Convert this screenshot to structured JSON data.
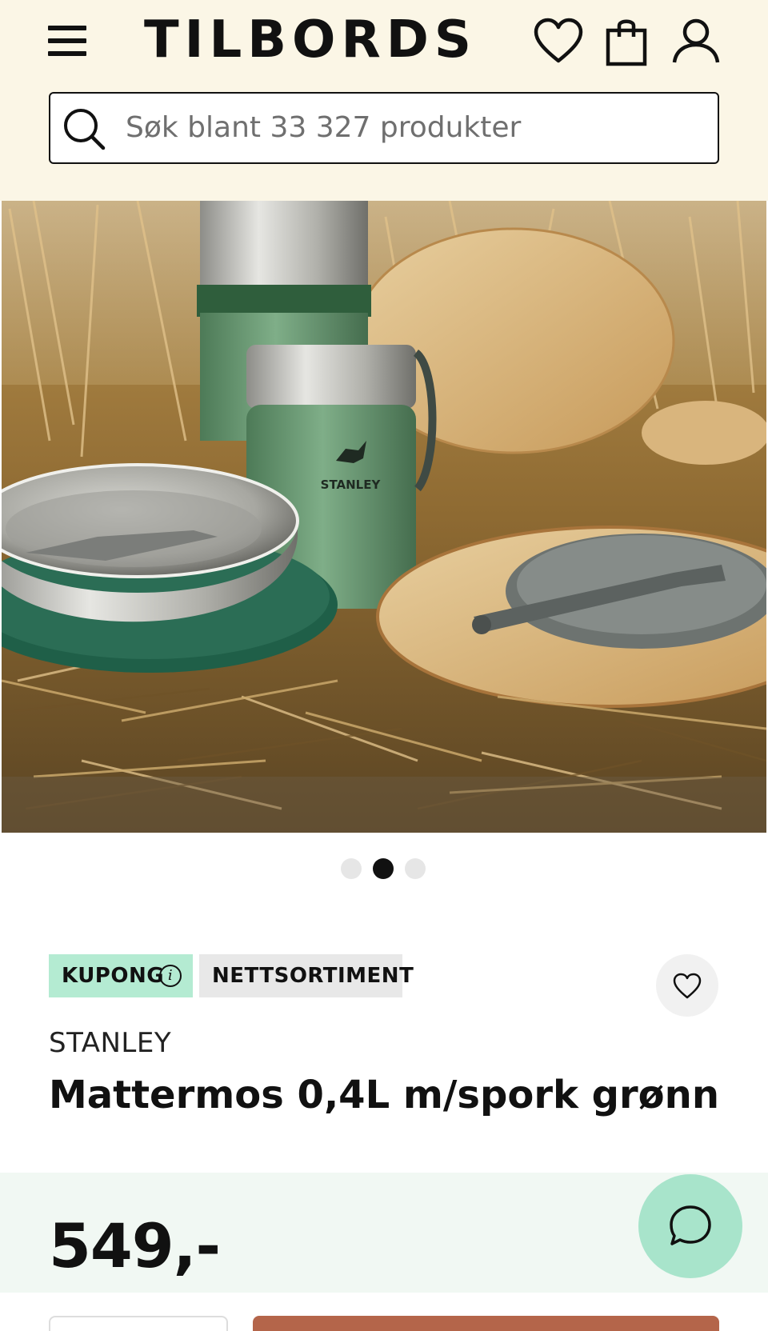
{
  "header": {
    "logo": "TILBORDS",
    "search": {
      "placeholder": "Søk blant 33 327 produkter",
      "value": ""
    }
  },
  "icons": {
    "menu": "menu-icon",
    "favorites": "heart-icon",
    "cart": "shopping-bag-icon",
    "account": "user-icon",
    "search": "search-icon",
    "chat": "chat-bubble-icon"
  },
  "carousel": {
    "slide_count": 3,
    "active_index": 1
  },
  "product": {
    "badges": [
      {
        "label": "KUPONG",
        "info_glyph": "i"
      },
      {
        "label": "NETTSORTIMENT"
      }
    ],
    "brand": "STANLEY",
    "title": "Mattermos 0,4L m/spork grønn",
    "price": "549,-"
  },
  "hero_image": {
    "thermos_brand": "STANLEY"
  },
  "colors": {
    "header_bg": "#fbf6e6",
    "coupon_badge": "#b4ebd2",
    "price_band": "#f1f8f3",
    "chat_button": "#a8e4cb",
    "buy_button": "#b4654a"
  }
}
